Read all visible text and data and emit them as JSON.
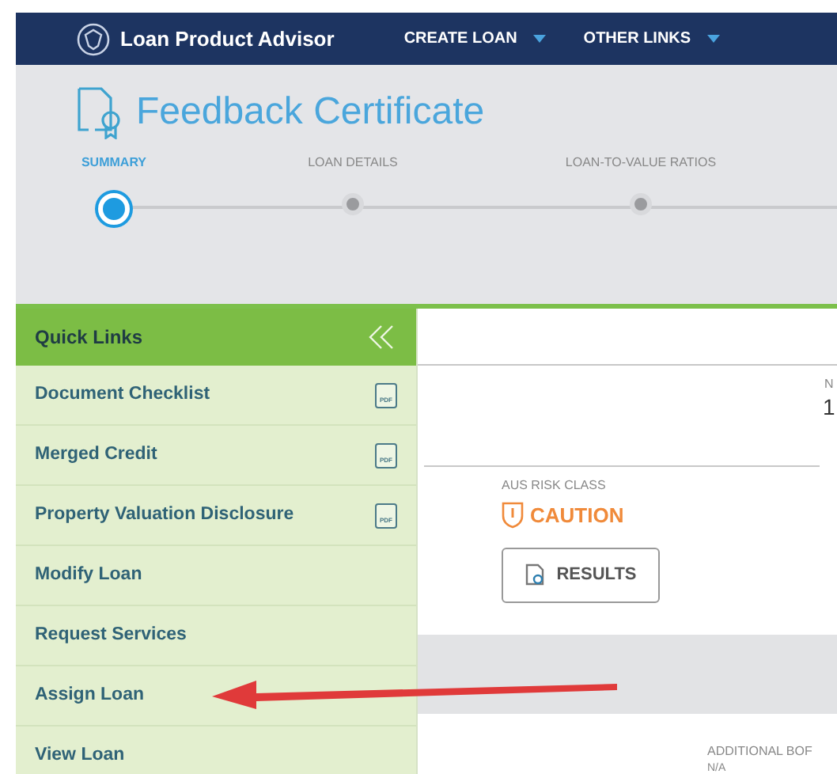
{
  "top_bar": {
    "app_name": "Loan Product Advisor",
    "menus": [
      {
        "label": "CREATE LOAN"
      },
      {
        "label": "OTHER LINKS"
      }
    ]
  },
  "page_title": "Feedback Certificate",
  "steps": [
    {
      "label": "SUMMARY",
      "selected": true
    },
    {
      "label": "LOAN DETAILS",
      "selected": false
    },
    {
      "label": "LOAN-TO-VALUE RATIOS",
      "selected": false
    }
  ],
  "quick_links": {
    "title": "Quick Links",
    "items": [
      {
        "label": "Document Checklist",
        "kind": "pdf",
        "icon_text": "PDF"
      },
      {
        "label": "Merged Credit",
        "kind": "pdf",
        "icon_text": "PDF"
      },
      {
        "label": "Property Valuation Disclosure",
        "kind": "pdf",
        "icon_text": "PDF"
      },
      {
        "label": "Modify Loan",
        "kind": "link"
      },
      {
        "label": "Request Services",
        "kind": "link"
      },
      {
        "label": "Assign Loan",
        "kind": "link"
      },
      {
        "label": "View Loan",
        "kind": "link"
      }
    ]
  },
  "summary": {
    "column_2_label": "N",
    "column_2_value": "1",
    "risk_label": "AUS RISK CLASS",
    "risk_value": "CAUTION",
    "results_button": "RESULTS",
    "additional_label": "ADDITIONAL BOF",
    "additional_value": "N/A"
  }
}
